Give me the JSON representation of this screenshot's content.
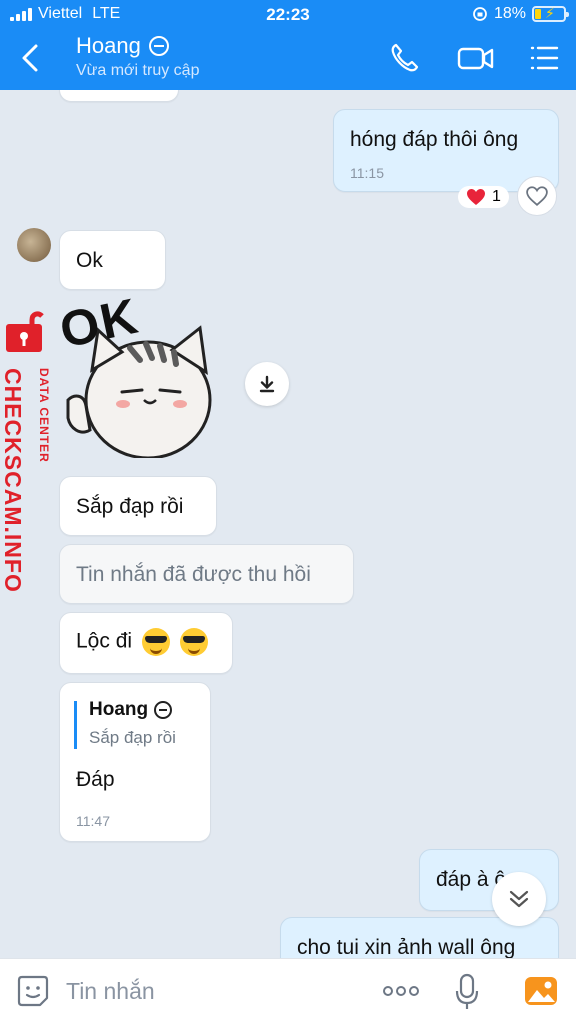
{
  "status_bar": {
    "carrier": "Viettel",
    "network": "LTE",
    "time": "22:23",
    "battery": "18%"
  },
  "header": {
    "contact_name": "Hoang",
    "status": "Vừa mới truy cập"
  },
  "messages": {
    "m1_text": "hóng đáp thôi ông",
    "m1_time": "11:15",
    "m1_reaction_count": "1",
    "m2_text": "Ok",
    "sticker_text": "OK",
    "m3_text": "Sắp đạp rồi",
    "m4_text": "Tin nhắn đã được thu hồi",
    "m5_text": "Lộc đi",
    "m6_quote_name": "Hoang",
    "m6_quote_text": "Sắp đạp rồi",
    "m6_text": "Đáp",
    "m6_time": "11:47",
    "m7_text": "đáp à ông",
    "m8_text": "cho tui xin ảnh wall ông"
  },
  "watermark": {
    "main": "CHECKSCAM.INFO",
    "sub": "DATA CENTER"
  },
  "input": {
    "placeholder": "Tin nhắn",
    "more": "ooo"
  },
  "colors": {
    "header_bg": "#1a8cf6",
    "chat_bg": "#e2e9f1",
    "my_bubble": "#def1ff",
    "their_bubble": "#ffffff",
    "watermark": "#e0212a"
  }
}
